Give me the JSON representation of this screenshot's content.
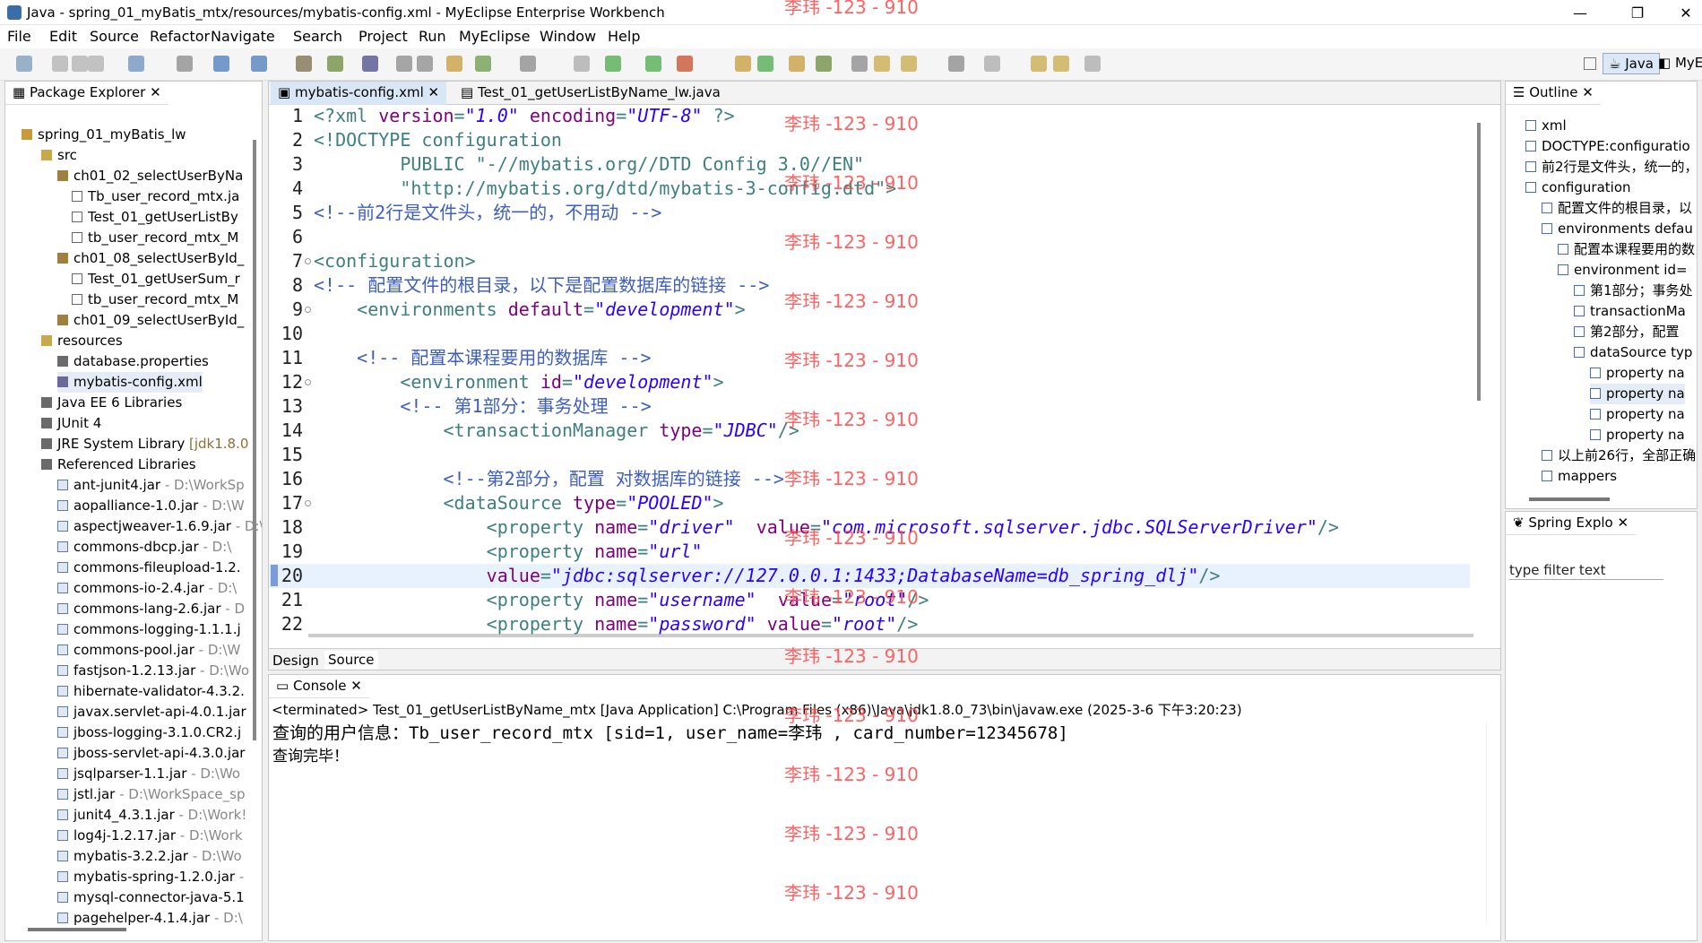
{
  "window": {
    "title": "Java - spring_01_myBatis_mtx/resources/mybatis-config.xml - MyEclipse Enterprise Workbench"
  },
  "menus": [
    "File",
    "Edit",
    "Source",
    "Refactor",
    "Navigate",
    "Search",
    "Project",
    "Run",
    "MyEclipse",
    "Window",
    "Help"
  ],
  "perspectives": [
    "Java",
    "MyE"
  ],
  "package_explorer": {
    "title": "Package Explorer",
    "items": [
      "spring_01_myBatis_lw",
      "src",
      "ch01_02_selectUserByNa",
      "Tb_user_record_mtx.ja",
      "Test_01_getUserListBy",
      "tb_user_record_mtx_M",
      "ch01_08_selectUserById_",
      "Test_01_getUserSum_r",
      "tb_user_record_mtx_M",
      "ch01_09_selectUserById_",
      "resources",
      "database.properties",
      "mybatis-config.xml",
      "Java EE 6 Libraries",
      "JUnit 4",
      "JRE System Library",
      "Referenced Libraries",
      "ant-junit4.jar",
      "aopalliance-1.0.jar",
      "aspectjweaver-1.6.9.jar",
      "commons-dbcp.jar",
      "commons-fileupload-1.2.",
      "commons-io-2.4.jar",
      "commons-lang-2.6.jar",
      "commons-logging-1.1.1.j",
      "commons-pool.jar",
      "fastjson-1.2.13.jar",
      "hibernate-validator-4.3.2.",
      "javax.servlet-api-4.0.1.jar",
      "jboss-logging-3.1.0.CR2.j",
      "jboss-servlet-api-4.3.0.jar",
      "jsqlparser-1.1.jar",
      "jstl.jar",
      "junit4_4.3.1.jar",
      "log4j-1.2.17.jar",
      "mybatis-3.2.2.jar",
      "mybatis-spring-1.2.0.jar",
      "mysql-connector-java-5.1",
      "pagehelper-4.1.4.jar"
    ],
    "suffixes": {
      "15": " [jdk1.8.0",
      "17": " - D:\\WorkSp",
      "18": " - D:\\W",
      "19": " - D:\\W",
      "20": " - D:\\",
      "21": "",
      "22": " - D:\\",
      "23": " - D",
      "24": "",
      "25": " - D:\\W",
      "26": " - D:\\Wo",
      "27": "",
      "28": "",
      "29": "",
      "30": "",
      "31": " - D:\\Wo",
      "32": " - D:\\WorkSpace_sp",
      "33": " - D:\\Work!",
      "34": " - D:\\Work",
      "35": " - D:\\Wo",
      "36": " -",
      "37": "",
      "38": " - D:\\"
    }
  },
  "editor": {
    "tabs": [
      "mybatis-config.xml",
      "Test_01_getUserListByName_lw.java"
    ],
    "bottom_tabs": [
      "Design",
      "Source"
    ],
    "lines": [
      [
        [
          "tag",
          "<?xml "
        ],
        [
          "attr",
          "version"
        ],
        [
          "tag",
          "="
        ],
        [
          "val",
          "\"1.0\""
        ],
        [
          "tag",
          " "
        ],
        [
          "attr",
          "encoding"
        ],
        [
          "tag",
          "="
        ],
        [
          "val",
          "\"UTF-8\""
        ],
        [
          "tag",
          " ?>"
        ]
      ],
      [
        [
          "tag",
          "<!DOCTYPE configuration"
        ]
      ],
      [
        [
          "tag",
          "        PUBLIC \"-//mybatis.org//DTD Config 3.0//EN\""
        ]
      ],
      [
        [
          "tag",
          "        \"http://mybatis.org/dtd/mybatis-3-config.dtd\">"
        ]
      ],
      [
        [
          "cmt",
          "<!--前2行是文件头，统一的，不用动 -->"
        ]
      ],
      [
        [
          "tag",
          ""
        ]
      ],
      [
        [
          "tag",
          "<configuration>"
        ]
      ],
      [
        [
          "cmt",
          "<!-- 配置文件的根目录，以下是配置数据库的链接 -->"
        ]
      ],
      [
        [
          "tag",
          "    <environments "
        ],
        [
          "attr",
          "default"
        ],
        [
          "tag",
          "="
        ],
        [
          "val",
          "\"development\""
        ],
        [
          "tag",
          ">"
        ]
      ],
      [
        [
          "tag",
          ""
        ]
      ],
      [
        [
          "cmt",
          "    <!-- 配置本课程要用的数据库 -->"
        ]
      ],
      [
        [
          "tag",
          "        <environment "
        ],
        [
          "attr",
          "id"
        ],
        [
          "tag",
          "="
        ],
        [
          "val",
          "\"development\""
        ],
        [
          "tag",
          ">"
        ]
      ],
      [
        [
          "cmt",
          "        <!-- 第1部分：事务处理 -->"
        ]
      ],
      [
        [
          "tag",
          "            <transactionManager "
        ],
        [
          "attr",
          "type"
        ],
        [
          "tag",
          "="
        ],
        [
          "val",
          "\"JDBC\""
        ],
        [
          "tag",
          "/>"
        ]
      ],
      [
        [
          "tag",
          ""
        ]
      ],
      [
        [
          "cmt",
          "            <!--第2部分，配置 对数据库的链接 -->"
        ]
      ],
      [
        [
          "tag",
          "            <dataSource "
        ],
        [
          "attr",
          "type"
        ],
        [
          "tag",
          "="
        ],
        [
          "val",
          "\"POOLED\""
        ],
        [
          "tag",
          ">"
        ]
      ],
      [
        [
          "tag",
          "                <property "
        ],
        [
          "attr",
          "name"
        ],
        [
          "tag",
          "="
        ],
        [
          "val",
          "\"driver\""
        ],
        [
          "tag",
          "  "
        ],
        [
          "attr",
          "value"
        ],
        [
          "tag",
          "="
        ],
        [
          "val",
          "\"com.microsoft.sqlserver.jdbc.SQLServerDriver\""
        ],
        [
          "tag",
          "/>"
        ]
      ],
      [
        [
          "tag",
          "                <property "
        ],
        [
          "attr",
          "name"
        ],
        [
          "tag",
          "="
        ],
        [
          "val",
          "\"url\""
        ]
      ],
      [
        [
          "attr",
          "                value"
        ],
        [
          "tag",
          "="
        ],
        [
          "val",
          "\"jdbc:sqlserver://127.0.0.1:1433;DatabaseName=db_spring_dlj\""
        ],
        [
          "tag",
          "/>"
        ]
      ],
      [
        [
          "tag",
          "                <property "
        ],
        [
          "attr",
          "name"
        ],
        [
          "tag",
          "="
        ],
        [
          "val",
          "\"username\""
        ],
        [
          "tag",
          "  "
        ],
        [
          "attr",
          "value"
        ],
        [
          "tag",
          "="
        ],
        [
          "val",
          "\"root\""
        ],
        [
          "tag",
          "/>"
        ]
      ],
      [
        [
          "tag",
          "                <property "
        ],
        [
          "attr",
          "name"
        ],
        [
          "tag",
          "="
        ],
        [
          "val",
          "\"password\""
        ],
        [
          "tag",
          " "
        ],
        [
          "attr",
          "value"
        ],
        [
          "tag",
          "="
        ],
        [
          "val",
          "\"root\""
        ],
        [
          "tag",
          "/>"
        ]
      ]
    ]
  },
  "outline": {
    "title": "Outline",
    "items": [
      "xml",
      "DOCTYPE:configuratio",
      "前2行是文件头，统一的，",
      "configuration",
      "配置文件的根目录，以",
      "environments defau",
      "配置本课程要用的数",
      "environment id=",
      "第1部分；事务处",
      "transactionMa",
      "第2部分，配置",
      "dataSource typ",
      "property na",
      "property na",
      "property na",
      "property na",
      "以上前26行，全部正确",
      "mappers"
    ]
  },
  "spring": {
    "title": "Spring Explo",
    "filter": "type filter text"
  },
  "console": {
    "title": "Console",
    "status": "<terminated> Test_01_getUserListByName_mtx [Java Application] C:\\Program Files (x86)\\Java\\jdk1.8.0_73\\bin\\javaw.exe (2025-3-6 下午3:20:23)",
    "lines": [
      "查询的用户信息：Tb_user_record_mtx [sid=1, user_name=李玮  , card_number=12345678]",
      "查询完毕！"
    ]
  },
  "watermark": "李玮 -123 - 910"
}
